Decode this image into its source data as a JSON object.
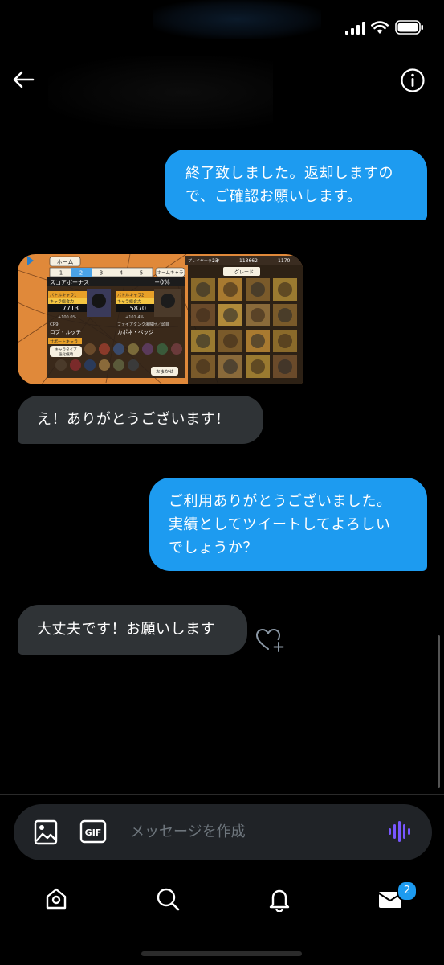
{
  "conversation": {
    "messages": [
      {
        "from": "me",
        "text_lines": [
          "終了致しました。返却しますの",
          "で、ご確認お願いします。"
        ]
      },
      {
        "from": "me",
        "type": "image",
        "image": {
          "tabs": [
            "ホーム"
          ],
          "page_tabs": [
            "1",
            "2",
            "3",
            "4",
            "5"
          ],
          "home_chara_label": "ホームキャラ",
          "rank_label": "プレイヤーランク",
          "rank_value": "23",
          "berry": "113662",
          "gems": "1170",
          "score_bonus_label": "スコアボーナス",
          "score_bonus_value": "+0%",
          "battle_chara_1_label": "バトルキャラ1",
          "battle_chara_2_label": "バトルキャラ2",
          "power_label": "キャラ総合力",
          "power_1": "7713",
          "power_2": "5870",
          "stat_1": "+100.0%",
          "stat_2": "+101.4%",
          "group_1": "CP9",
          "group_2": "ファイアタンク海賊団／頭目",
          "name_1": "ロブ・ルッチ",
          "name_2": "カポネ・ベッジ",
          "support_label": "サポートキャラ",
          "chara_type_label": "キャラタイプ",
          "chara_type_sub": "強化値順",
          "grade_label": "グレード",
          "auto_label": "おまかせ"
        }
      },
      {
        "from": "them",
        "text_lines": [
          "え！ありがとうございます！"
        ]
      },
      {
        "from": "me",
        "text_lines": [
          "ご利用ありがとうございました。",
          "実績としてツイートしてよろしい",
          "でしょうか？"
        ]
      },
      {
        "from": "them",
        "text_lines": [
          "大丈夫です！お願いします"
        ]
      }
    ]
  },
  "composer": {
    "placeholder": "メッセージを作成",
    "gif_label": "GIF"
  },
  "tabbar": {
    "messages_badge": "2"
  },
  "colors": {
    "sent_bubble": "#1d9bf0",
    "received_bubble": "#2f3336",
    "background": "#000000",
    "accent_voice": "#7856ff"
  },
  "icons": [
    "signal-icon",
    "wifi-icon",
    "battery-icon",
    "back-arrow-icon",
    "info-icon",
    "heart-add-icon",
    "image-icon",
    "gif-icon",
    "voice-wave-icon",
    "home-icon",
    "search-icon",
    "bell-icon",
    "mail-icon"
  ]
}
